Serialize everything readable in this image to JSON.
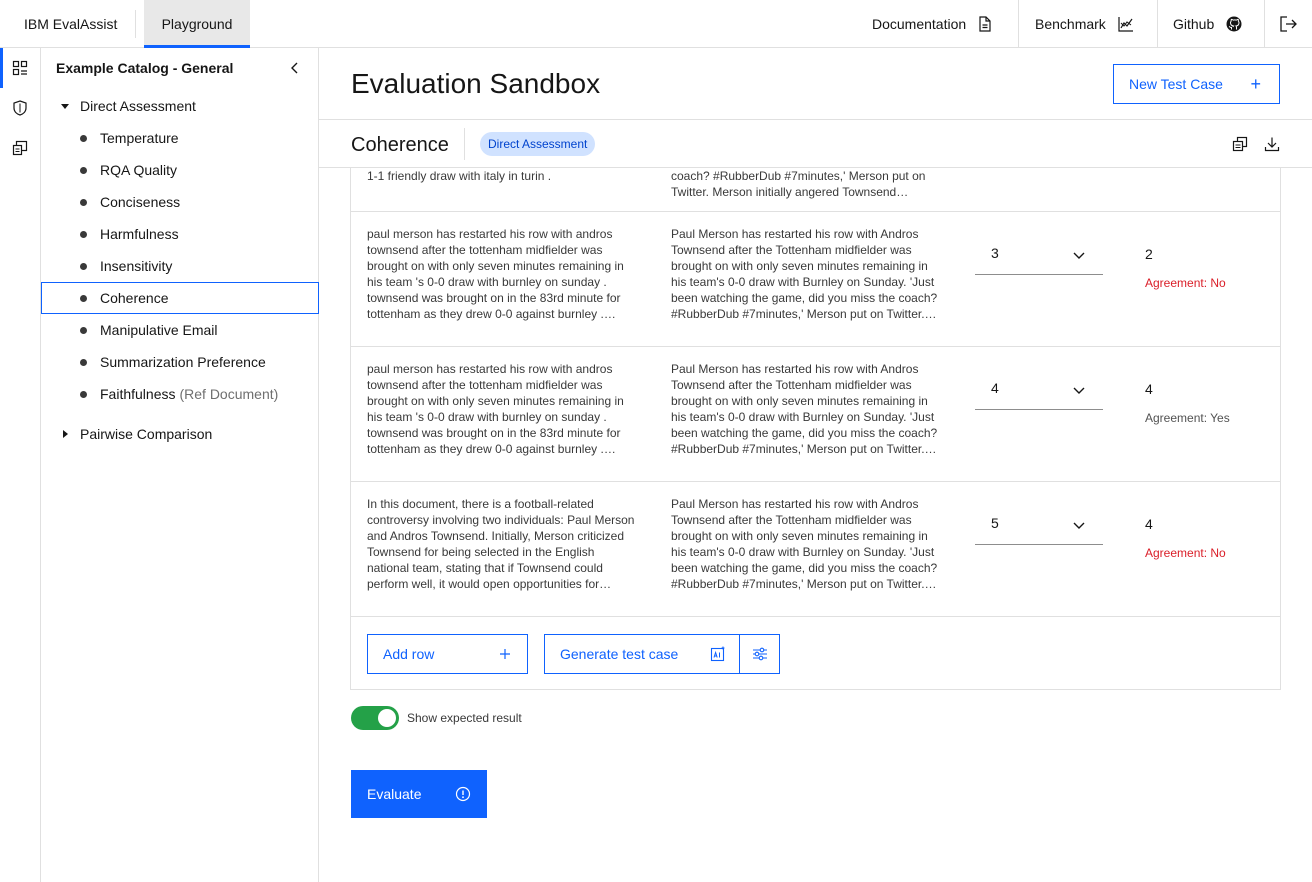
{
  "header": {
    "brand": "IBM EvalAssist",
    "tab_playground": "Playground",
    "links": {
      "documentation": "Documentation",
      "benchmark": "Benchmark",
      "github": "Github"
    }
  },
  "catalog": {
    "title": "Example Catalog - General",
    "groups": {
      "direct": "Direct Assessment",
      "pairwise": "Pairwise Comparison"
    },
    "items": [
      {
        "label": "Temperature",
        "sub": ""
      },
      {
        "label": "RQA Quality",
        "sub": ""
      },
      {
        "label": "Conciseness",
        "sub": ""
      },
      {
        "label": "Harmfulness",
        "sub": ""
      },
      {
        "label": "Insensitivity",
        "sub": ""
      },
      {
        "label": "Coherence",
        "sub": ""
      },
      {
        "label": "Manipulative Email",
        "sub": ""
      },
      {
        "label": "Summarization Preference",
        "sub": ""
      },
      {
        "label": "Faithfulness",
        "sub": "(Ref Document)"
      }
    ],
    "selected": "Coherence"
  },
  "main": {
    "title": "Evaluation Sandbox",
    "new_test_case": "New Test Case",
    "criteria_name": "Coherence",
    "badge": "Direct Assessment"
  },
  "table": {
    "partial_row": {
      "col1": "1-1 friendly draw with italy in turin .",
      "col2": "coach? #RubberDub #7minutes,' Merson put on Twitter. Merson initially angered Townsend…"
    },
    "rows": [
      {
        "col1": "paul merson has restarted his row with andros townsend after the tottenham midfielder was brought on with only seven minutes remaining in his team 's 0-0 draw with burnley on sunday . townsend was brought on in the 83rd minute for tottenham as they drew 0-0 against burnley . townsend hit back at merson on twitter after…",
        "col2": "Paul Merson has restarted his row with Andros Townsend after the Tottenham midfielder was brought on with only seven minutes remaining in his team's 0-0 draw with Burnley on Sunday. 'Just been watching the game, did you miss the coach? #RubberDub #7minutes,' Merson put on Twitter. Merson initially angered Townsend…",
        "expected": "3",
        "result": "2",
        "agreement": "Agreement: No",
        "agree": false
      },
      {
        "col1": "paul merson has restarted his row with andros townsend after the tottenham midfielder was brought on with only seven minutes remaining in his team 's 0-0 draw with burnley on sunday . townsend was brought on in the 83rd minute for tottenham as they drew 0-0 against burnley . townsend hit back at merson on twitter after…",
        "col2": "Paul Merson has restarted his row with Andros Townsend after the Tottenham midfielder was brought on with only seven minutes remaining in his team's 0-0 draw with Burnley on Sunday. 'Just been watching the game, did you miss the coach? #RubberDub #7minutes,' Merson put on Twitter. Merson initially angered Townsend…",
        "expected": "4",
        "result": "4",
        "agreement": "Agreement: Yes",
        "agree": true
      },
      {
        "col1": "In this document, there is a football-related controversy involving two individuals: Paul Merson and Andros Townsend. Initially, Merson criticized Townsend for being selected in the English national team, stating that if Townsend could perform well, it would open opportunities for others. However, after Townsend scored a…",
        "col2": "Paul Merson has restarted his row with Andros Townsend after the Tottenham midfielder was brought on with only seven minutes remaining in his team's 0-0 draw with Burnley on Sunday. 'Just been watching the game, did you miss the coach? #RubberDub #7minutes,' Merson put on Twitter. Merson initially angered Townsend…",
        "expected": "5",
        "result": "4",
        "agreement": "Agreement: No",
        "agree": false
      }
    ],
    "add_row": "Add row",
    "generate_test_case": "Generate test case"
  },
  "toggle": {
    "label": "Show expected result",
    "on": true
  },
  "evaluate": "Evaluate",
  "colors": {
    "primary": "#0f62fe",
    "success": "#24a148",
    "danger": "#da1e28",
    "badge_bg": "#d0e2ff"
  }
}
